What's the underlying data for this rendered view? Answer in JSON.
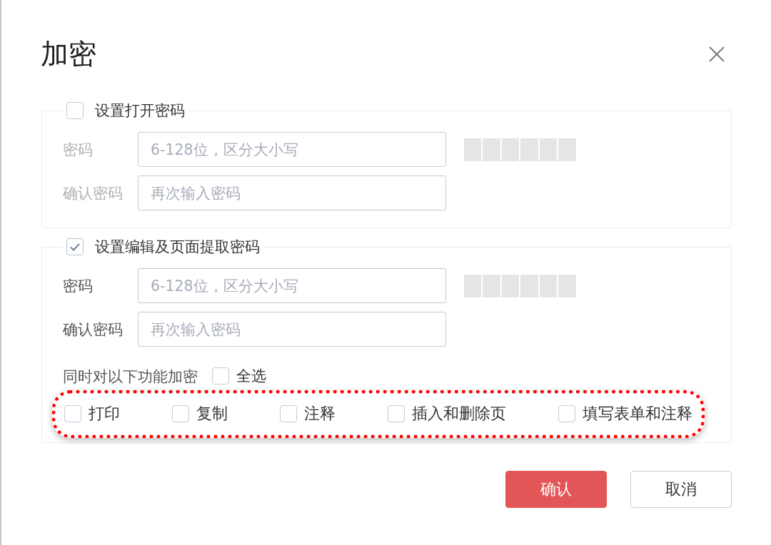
{
  "dialog": {
    "title": "加密"
  },
  "sections": [
    {
      "title": "设置打开密码",
      "checked": false,
      "fields": [
        {
          "label": "密码",
          "placeholder": "6-128位，区分大小写",
          "meter": {
            "level": 0
          }
        },
        {
          "label": "确认密码",
          "placeholder": "再次输入密码"
        }
      ]
    },
    {
      "title": "设置编辑及页面提取密码",
      "checked": true,
      "fields": [
        {
          "label": "密码",
          "placeholder": "6-128位，区分大小写",
          "meter": {
            "level": 0
          }
        },
        {
          "label": "确认密码",
          "placeholder": "再次输入密码"
        }
      ],
      "permissions": {
        "label": "同时对以下功能加密",
        "select_all": {
          "label": "全选",
          "checked": false
        },
        "highlighted": true,
        "options": [
          {
            "label": "打印",
            "checked": false
          },
          {
            "label": "复制",
            "checked": false
          },
          {
            "label": "注释",
            "checked": false
          },
          {
            "label": "插入和删除页",
            "checked": false
          },
          {
            "label": "填写表单和注释",
            "checked": false
          }
        ]
      }
    }
  ],
  "buttons": [
    {
      "label": "确认",
      "kind": "primary"
    },
    {
      "label": "取消",
      "kind": "secondary"
    }
  ]
}
